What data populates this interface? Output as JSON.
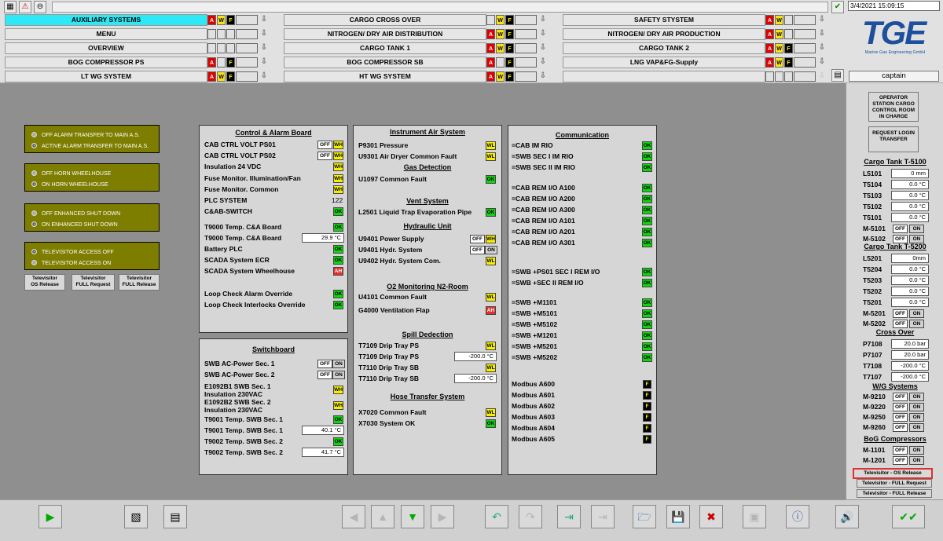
{
  "header": {
    "datetime": "3/4/2021 15:09:15",
    "user": "captain",
    "logo": {
      "text": "TGE",
      "subtitle": "Marine Gas Engineering GmbH",
      "color": "#1e4f9c"
    }
  },
  "nav": {
    "col1": [
      {
        "label": "AUXILIARY SYSTEMS",
        "active": true
      },
      {
        "label": "MENU"
      },
      {
        "label": "OVERVIEW"
      },
      {
        "label": "BOG COMPRESSOR PS"
      },
      {
        "label": "LT WG SYSTEM"
      }
    ],
    "col2": [
      {
        "label": "CARGO CROSS OVER"
      },
      {
        "label": "NITROGEN/ DRY AIR DISTRIBUTION"
      },
      {
        "label": "CARGO TANK 1"
      },
      {
        "label": "BOG COMPRESSOR SB"
      },
      {
        "label": "HT WG SYSTEM"
      }
    ],
    "col3": [
      {
        "label": "SAFETY STYSTEM"
      },
      {
        "label": "NITROGEN/ DRY AIR PRODUCTION"
      },
      {
        "label": "CARGO TANK 2"
      },
      {
        "label": "LNG VAP&FG-Supply"
      },
      {
        "label": ""
      }
    ],
    "alarm_letters": {
      "a": "A",
      "w": "W",
      "f": "F"
    }
  },
  "left": {
    "group1": [
      "OFF ALARM TRANSFER TO MAIN A.S.",
      "ACTIVE  ALARM TRANSFER TO MAIN A.S."
    ],
    "group2": [
      "OFF HORN WHEELHOUSE",
      "ON HORN WHEELHOUSE"
    ],
    "group3": [
      "OFF ENHANCED SHUT DOWN",
      "ON   ENHANCED SHUT DOWN"
    ],
    "group4": [
      "TELEVISITOR ACCESS OFF",
      "TELEVISITOR ACCESS ON"
    ],
    "buttons": [
      {
        "l1": "Televisitor",
        "l2": "OS Release"
      },
      {
        "l1": "Televisitor",
        "l2": "FULL Request"
      },
      {
        "l1": "Televisitor",
        "l2": "FULL Release"
      }
    ]
  },
  "control": {
    "title": "Control & Alarm Board",
    "rows": [
      {
        "label": "CAB CTRL VOLT PS01",
        "s": "OFF",
        "b": "WH"
      },
      {
        "label": "CAB CTRL VOLT PS02",
        "s": "OFF",
        "b": "WH"
      },
      {
        "label": "Insulation 24 VDC",
        "b": "WH"
      },
      {
        "label": "Fuse Monitor. Illumination/Fan",
        "b": "WH"
      },
      {
        "label": "Fuse Monitor. Common",
        "b": "WH"
      },
      {
        "label": "PLC SYSTEM",
        "v": "122"
      },
      {
        "label": "C&AB-SWITCH",
        "b": "OK"
      },
      {
        "label": "T9000 Temp. C&A Board",
        "b": "OK"
      },
      {
        "label": "T9000 Temp. C&A Board",
        "val": "29.9  °C"
      },
      {
        "label": "Battery PLC",
        "b": "OK"
      },
      {
        "label": "SCADA System ECR",
        "b": "OK"
      },
      {
        "label": "SCADA System Wheelhouse",
        "b": "AH"
      },
      {
        "label": "Loop Check Alarm Override",
        "b": "OK"
      },
      {
        "label": "Loop Check Interlocks Override",
        "b": "OK"
      }
    ]
  },
  "switchboard": {
    "title": "Switchboard",
    "rows": [
      {
        "label": "SWB AC-Power Sec. 1",
        "s": "OFF",
        "on": "ON"
      },
      {
        "label": "SWB AC-Power Sec. 2",
        "s": "OFF",
        "on": "ON"
      },
      {
        "label": "E1092B1 SWB Sec. 1",
        "label2": "Insulation 230VAC",
        "b": "WH"
      },
      {
        "label": "E1092B2 SWB Sec. 2",
        "label2": "Insulation 230VAC",
        "b": "WH"
      },
      {
        "label": "T9001 Temp. SWB Sec. 1",
        "b": "OK"
      },
      {
        "label": "T9001 Temp. SWB Sec. 1",
        "val": "40.1  °C"
      },
      {
        "label": "T9002 Temp. SWB Sec. 2",
        "b": "OK"
      },
      {
        "label": "T9002 Temp. SWB Sec. 2",
        "val": "41.7  °C"
      }
    ]
  },
  "instrument": {
    "titles": {
      "air": "Instrument Air System",
      "gas": "Gas Detection",
      "vent": "Vent System",
      "hyd": "Hydraulic Unit",
      "o2": "O2 Monitoring N2-Room",
      "spill": "Spill Dedection",
      "hose": "Hose Transfer System"
    },
    "rows": [
      {
        "label": "P9301 Pressure",
        "b": "WL"
      },
      {
        "label": "U9301 Air Dryer Common Fault",
        "b": "WL"
      },
      {
        "label": "U1097 Common Fault",
        "b": "OK"
      },
      {
        "label": "L2501 Liquid Trap Evaporation Pipe",
        "b": "OK"
      },
      {
        "label": "U9401 Power Supply",
        "s": "OFF",
        "b": "WH"
      },
      {
        "label": "U9401  Hydr.  System",
        "s": "OFF",
        "on": "ON"
      },
      {
        "label": "U9402 Hydr. System Com.",
        "b": "WL"
      },
      {
        "label": "U4101 Common Fault",
        "b": "WL"
      },
      {
        "label": "G4000 Ventilation Flap",
        "b": "AH"
      },
      {
        "label": "T7109 Drip Tray PS",
        "b": "WL"
      },
      {
        "label": "T7109 Drip Tray PS",
        "val": "-200.0  °C"
      },
      {
        "label": "T7110 Drip Tray SB",
        "b": "WL"
      },
      {
        "label": "T7110 Drip Tray SB",
        "val": "-200.0  °C"
      },
      {
        "label": "X7020 Common Fault",
        "b": "WL"
      },
      {
        "label": "X7030 System OK",
        "b": "OK"
      }
    ]
  },
  "communication": {
    "title": "Communication",
    "rows": [
      "=CAB IM RIO",
      "=SWB SEC I IM RIO",
      "=SWB SEC II IM RIO",
      "=CAB REM I/O A100",
      "=CAB REM I/O A200",
      "=CAB REM I/O A300",
      "=CAB REM I/O A101",
      "=CAB REM I/O A201",
      "=CAB REM I/O A301",
      "=SWB +PS01 SEC I REM I/O",
      "=SWB +SEC II REM I/O",
      "=SWB +M1101",
      "=SWB +M5101",
      "=SWB +M5102",
      "=SWB +M1201",
      "=SWB +M5201",
      "=SWB +M5202"
    ],
    "modbus": [
      "Modbus A600",
      "Modbus A601",
      "Modbus A602",
      "Modbus A603",
      "Modbus A604",
      "Modbus A605"
    ],
    "ok": "OK",
    "f": "F"
  },
  "right": {
    "station": "OPERATOR STATION CARGO CONTROL ROOM IN CHARGE",
    "request": "REQUEST LOGIN TRANSFER",
    "tank1": {
      "title": "Cargo Tank T-5100",
      "rows": [
        {
          "l": "L5101",
          "v": "0 mm"
        },
        {
          "l": "T5104",
          "v": "0.0 °C"
        },
        {
          "l": "T5103",
          "v": "0.0 °C"
        },
        {
          "l": "T5102",
          "v": "0.0 °C"
        },
        {
          "l": "T5101",
          "v": "0.0 °C"
        }
      ],
      "m": [
        "M-5101",
        "M-5102"
      ]
    },
    "tank2": {
      "title": "Cargo Tank T-5200",
      "rows": [
        {
          "l": "L5201",
          "v": "0mm"
        },
        {
          "l": "T5204",
          "v": "0.0 °C"
        },
        {
          "l": "T5203",
          "v": "0.0 °C"
        },
        {
          "l": "T5202",
          "v": "0.0 °C"
        },
        {
          "l": "T5201",
          "v": "0.0 °C"
        }
      ],
      "m": [
        "M-5201",
        "M-5202"
      ]
    },
    "cross": {
      "title": "Cross Over",
      "rows": [
        {
          "l": "P7108",
          "v": "20.0  bar"
        },
        {
          "l": "P7107",
          "v": "20.0  bar"
        },
        {
          "l": "T7108",
          "v": "-200.0 °C"
        },
        {
          "l": "T7107",
          "v": "-200.0 °C"
        }
      ]
    },
    "wg": {
      "title": "W/G Systems",
      "m": [
        "M-9210",
        "M-9220",
        "M-9250",
        "M-9260"
      ]
    },
    "bog": {
      "title": "BoG Compressors",
      "m": [
        "M-1101",
        "M-1201"
      ]
    },
    "off": "OFF",
    "on": "ON",
    "tele": [
      "Televisitor - OS Release",
      "Televisitor - FULL Request",
      "Televisitor - FULL Release"
    ]
  }
}
